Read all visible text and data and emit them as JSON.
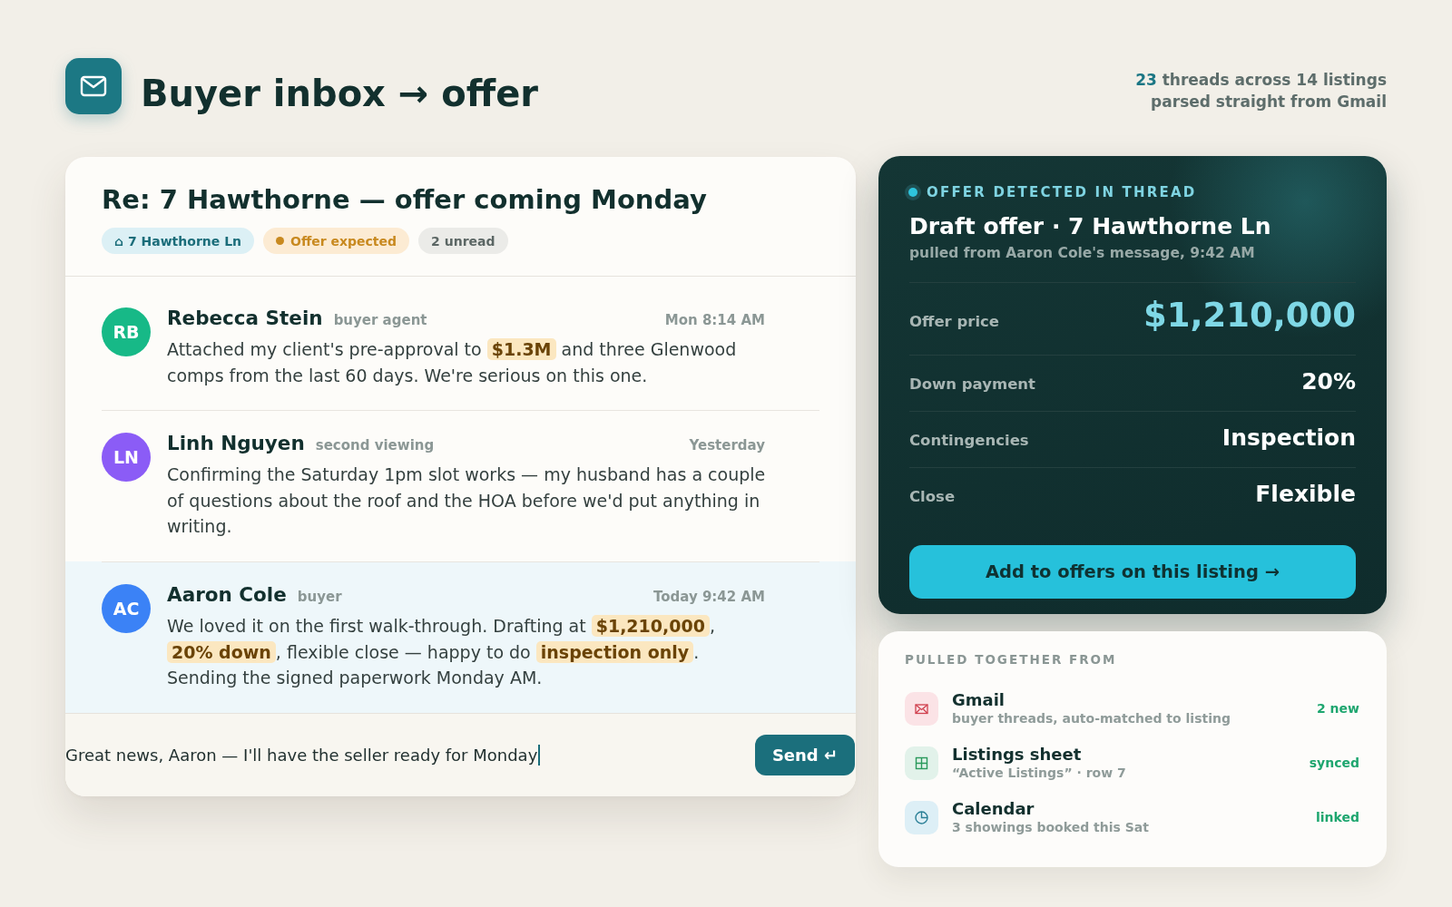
{
  "header": {
    "title": "Buyer inbox → offer",
    "summary": [
      "**23** threads across 14 listings",
      "parsed straight from Gmail"
    ]
  },
  "thread": {
    "subject": "Re: 7 Hawthorne — offer coming Monday",
    "tags": [
      {
        "kind": "listing",
        "label": "⌂ 7 Hawthorne Ln"
      },
      {
        "kind": "status",
        "label": "Offer expected"
      },
      {
        "kind": "count",
        "label": "2 unread"
      }
    ],
    "messages": [
      {
        "initials": "RB",
        "color": "#17b987",
        "sender": "Rebecca Stein",
        "role": "buyer agent",
        "time": "Mon 8:14 AM",
        "body": "Attached my client's pre-approval to **$1.3M** and three Glenwood comps from the last 60 days. We're serious on this one.",
        "selected": false
      },
      {
        "initials": "LN",
        "color": "#8b5cf6",
        "sender": "Linh Nguyen",
        "role": "second viewing",
        "time": "Yesterday",
        "body": "Confirming the Saturday 1pm slot works — my husband has a couple of questions about the roof and the HOA before we'd put anything in writing.",
        "selected": false
      },
      {
        "initials": "AC",
        "color": "#3b82f6",
        "sender": "Aaron Cole",
        "role": "buyer",
        "time": "Today 9:42 AM",
        "body": "We loved it on the first walk-through. Drafting at **$1,210,000**, **20% down**, flexible close — happy to do **inspection only**. Sending the signed paperwork Monday AM.",
        "selected": true
      }
    ],
    "reply": {
      "value": "Great news, Aaron — I'll have the seller ready for Monday",
      "focused": true
    },
    "send_button": "Send ↵"
  },
  "offer": {
    "eyebrow": "OFFER DETECTED IN THREAD",
    "title": "Draft offer · 7 Hawthorne Ln",
    "subtitle": "pulled from Aaron Cole's message, 9:42 AM",
    "terms": [
      {
        "kind": "price",
        "label": "Offer price",
        "value": "$1,210,000"
      },
      {
        "kind": "term",
        "label": "Down payment",
        "value": "20%"
      },
      {
        "kind": "term",
        "label": "Contingencies",
        "value": "Inspection"
      },
      {
        "kind": "term",
        "label": "Close",
        "value": "Flexible"
      }
    ],
    "button": "Add to offers on this listing →"
  },
  "sources": {
    "heading": "PULLED TOGETHER FROM",
    "items": [
      {
        "kind": "mail",
        "name": "Gmail",
        "detail": "buyer threads, auto-matched to listing",
        "status": "2 new"
      },
      {
        "kind": "sheet",
        "name": "Listings sheet",
        "detail": "“Active Listings” · row 7",
        "status": "synced"
      },
      {
        "kind": "calendar",
        "name": "Calendar",
        "detail": "3 showings booked this Sat",
        "status": "linked"
      }
    ]
  }
}
